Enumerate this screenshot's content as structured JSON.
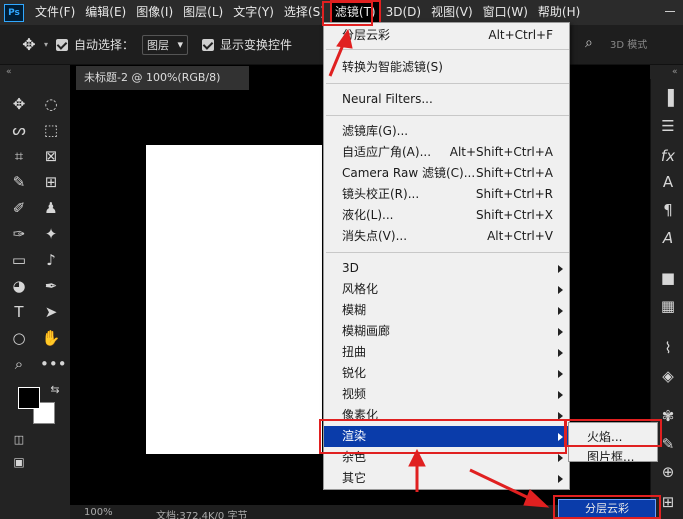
{
  "app": {
    "logo": "Ps"
  },
  "menubar": {
    "items": [
      "文件(F)",
      "编辑(E)",
      "图像(I)",
      "图层(L)",
      "文字(Y)",
      "选择(S)",
      "滤镜(T)",
      "3D(D)",
      "视图(V)",
      "窗口(W)",
      "帮助(H)"
    ],
    "active": "滤镜(T)"
  },
  "options": {
    "auto_select_label": "自动选择：",
    "auto_select_value": "图层",
    "show_transform_label": "显示变换控件",
    "right_label": "3D 模式"
  },
  "document": {
    "tab_title": "未标题-2 @ 100%(RGB/8)",
    "zoom": "100%",
    "status": "文档:372.4K/0 字节"
  },
  "filter_menu": {
    "items": [
      {
        "label": "分层云彩",
        "shortcut": "Alt+Ctrl+F"
      },
      {
        "label": "转换为智能滤镜(S)"
      },
      {
        "label": "Neural Filters..."
      },
      {
        "label": "滤镜库(G)..."
      },
      {
        "label": "自适应广角(A)...",
        "shortcut": "Alt+Shift+Ctrl+A"
      },
      {
        "label": "Camera Raw 滤镜(C)...",
        "shortcut": "Shift+Ctrl+A"
      },
      {
        "label": "镜头校正(R)...",
        "shortcut": "Shift+Ctrl+R"
      },
      {
        "label": "液化(L)...",
        "shortcut": "Shift+Ctrl+X"
      },
      {
        "label": "消失点(V)...",
        "shortcut": "Alt+Ctrl+V"
      },
      {
        "label": "3D",
        "submenu": true
      },
      {
        "label": "风格化",
        "submenu": true
      },
      {
        "label": "模糊",
        "submenu": true
      },
      {
        "label": "模糊画廊",
        "submenu": true
      },
      {
        "label": "扭曲",
        "submenu": true
      },
      {
        "label": "锐化",
        "submenu": true
      },
      {
        "label": "视频",
        "submenu": true
      },
      {
        "label": "像素化",
        "submenu": true
      },
      {
        "label": "渲染",
        "submenu": true,
        "highlighted": true
      },
      {
        "label": "杂色",
        "submenu": true
      },
      {
        "label": "其它",
        "submenu": true
      }
    ]
  },
  "render_submenu": {
    "items": [
      "火焰...",
      "图片框..."
    ]
  },
  "result_button": {
    "label": "分层云彩"
  },
  "colors": {
    "highlight": "#0a3caa",
    "annotation": "#e02020"
  }
}
